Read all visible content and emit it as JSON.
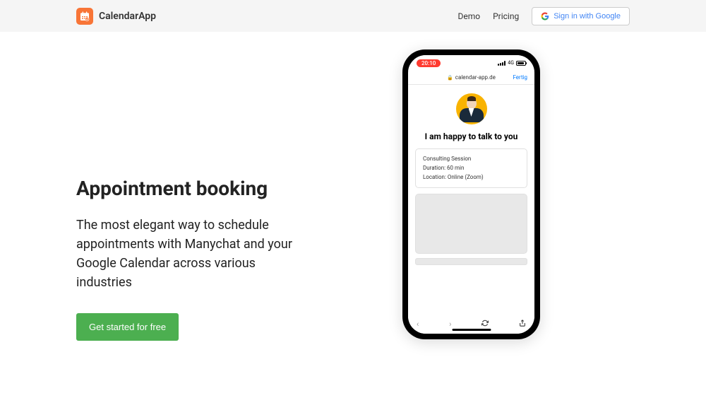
{
  "header": {
    "logo_text": "CalendarApp",
    "nav": {
      "demo": "Demo",
      "pricing": "Pricing"
    },
    "signin": "Sign in with Google"
  },
  "hero": {
    "heading": "Appointment booking",
    "subheading": "The most elegant way to schedule appointments with Manychat and your Google Calendar across various industries",
    "cta": "Get started for free"
  },
  "phone": {
    "time": "20:10",
    "network": "4G",
    "url": "calendar-app.de",
    "done": "Fertig",
    "greeting": "I am happy to talk to you",
    "session": {
      "title": "Consulting Session",
      "duration": "Duration: 60 min",
      "location": "Location: Online (Zoom)"
    }
  }
}
